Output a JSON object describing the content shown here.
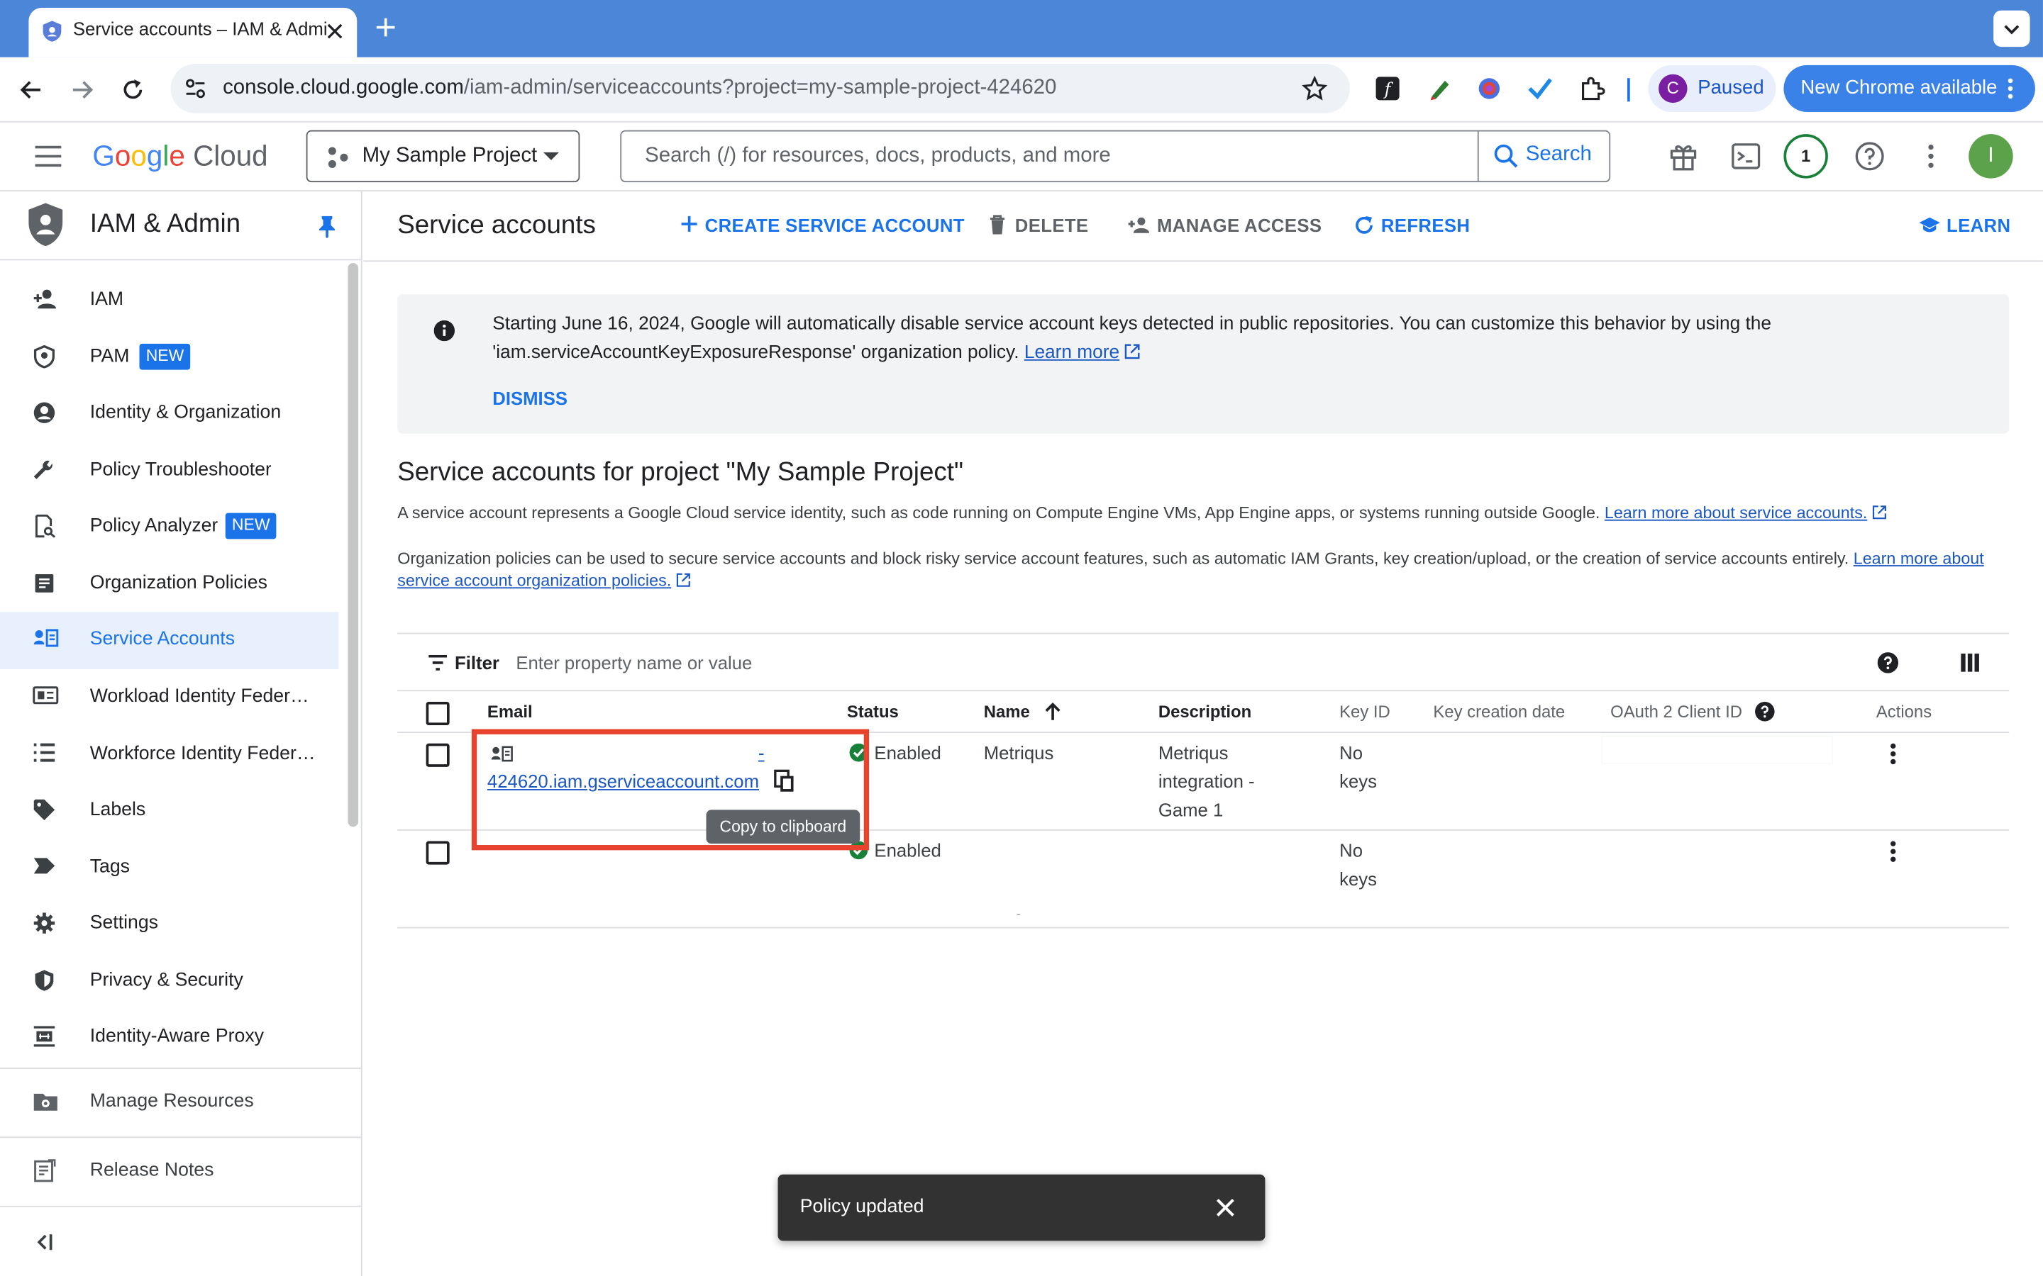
{
  "browser": {
    "tab_title": "Service accounts – IAM & Admin",
    "url_host": "console.cloud.google.com",
    "url_path": "/iam-admin/serviceaccounts?project=my-sample-project-424620",
    "profile_initial": "C",
    "profile_status": "Paused",
    "update_label": "New Chrome available"
  },
  "header": {
    "logo_text": "Google Cloud",
    "project": "My Sample Project",
    "search_placeholder": "Search (/) for resources, docs, products, and more",
    "search_button": "Search",
    "notifications_count": "1",
    "avatar_initial": "I"
  },
  "sidebar": {
    "title": "IAM & Admin",
    "items": [
      {
        "label": "IAM",
        "icon": "person-add-icon"
      },
      {
        "label": "PAM",
        "icon": "shield-check-icon",
        "badge": "NEW"
      },
      {
        "label": "Identity & Organization",
        "icon": "account-circle-icon"
      },
      {
        "label": "Policy Troubleshooter",
        "icon": "wrench-icon"
      },
      {
        "label": "Policy Analyzer",
        "icon": "doc-search-icon",
        "badge": "NEW"
      },
      {
        "label": "Organization Policies",
        "icon": "list-doc-icon"
      },
      {
        "label": "Service Accounts",
        "icon": "service-account-icon",
        "active": true
      },
      {
        "label": "Workload Identity Federat...",
        "icon": "id-card-icon"
      },
      {
        "label": "Workforce Identity Federa...",
        "icon": "list-icon"
      },
      {
        "label": "Labels",
        "icon": "label-icon"
      },
      {
        "label": "Tags",
        "icon": "tag-icon"
      },
      {
        "label": "Settings",
        "icon": "gear-icon"
      },
      {
        "label": "Privacy & Security",
        "icon": "shield-icon"
      },
      {
        "label": "Identity-Aware Proxy",
        "icon": "proxy-icon"
      }
    ],
    "manage_resources": "Manage Resources",
    "release_notes": "Release Notes"
  },
  "main": {
    "page_title": "Service accounts",
    "actions": {
      "create": "CREATE SERVICE ACCOUNT",
      "delete": "DELETE",
      "manage_access": "MANAGE ACCESS",
      "refresh": "REFRESH",
      "learn": "LEARN"
    },
    "banner": {
      "text": "Starting June 16, 2024, Google will automatically disable service account keys detected in public repositories. You can customize this behavior by using the 'iam.serviceAccountKeyExposureResponse' organization policy.",
      "link": "Learn more",
      "dismiss": "DISMISS"
    },
    "section_title": "Service accounts for project \"My Sample Project\"",
    "para1": "A service account represents a Google Cloud service identity, such as code running on Compute Engine VMs, App Engine apps, or systems running outside Google.",
    "para1_link": "Learn more about service accounts.",
    "para2": "Organization policies can be used to secure service accounts and block risky service account features, such as automatic IAM Grants, key creation/upload, or the creation of service accounts entirely.",
    "para2_link": "Learn more about service account organization policies.",
    "filter_label": "Filter",
    "filter_placeholder": "Enter property name or value",
    "columns": [
      "Email",
      "Status",
      "Name",
      "Description",
      "Key ID",
      "Key creation date",
      "OAuth 2 Client ID",
      "Actions"
    ],
    "rows": [
      {
        "email_line1": "-",
        "email_line2": "424620.iam.gserviceaccount.com",
        "status": "Enabled",
        "name": "Metriqus",
        "description": "Metriqus integration - Game 1",
        "key_id": "No keys"
      },
      {
        "email_line1": "",
        "email_line2": "",
        "status": "Enabled",
        "name": "",
        "description": "",
        "key_id": "No keys"
      }
    ],
    "tooltip": "Copy to clipboard",
    "trailing_mark": "-"
  },
  "snackbar": {
    "message": "Policy updated"
  },
  "colors": {
    "accent": "#1a73e8",
    "tabstrip": "#4c86d9",
    "status_green": "#188038",
    "highlight_red": "#e8432e"
  }
}
